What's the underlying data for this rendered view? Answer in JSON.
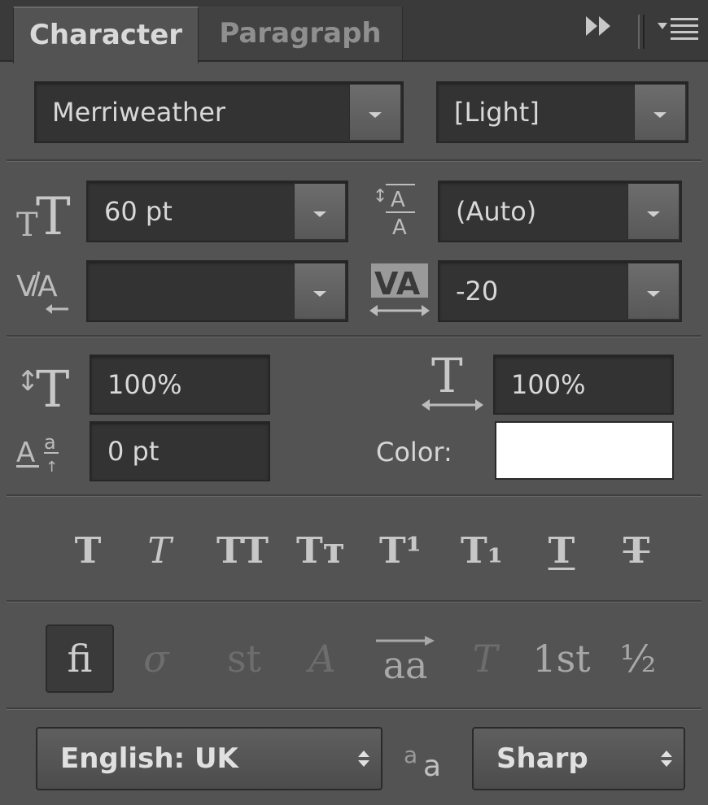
{
  "tabs": {
    "active": "Character",
    "inactive": "Paragraph"
  },
  "font": {
    "family": "Merriweather",
    "style": "[Light]"
  },
  "size": {
    "font_size": "60 pt",
    "leading": "(Auto)"
  },
  "spacing": {
    "kerning": "",
    "tracking": "-20"
  },
  "scale": {
    "vertical": "100%",
    "horizontal": "100%"
  },
  "baseline": {
    "shift": "0 pt"
  },
  "color": {
    "label": "Color:",
    "value": "#ffffff"
  },
  "type_styles": [
    {
      "name": "faux-bold-button",
      "glyph": "T"
    },
    {
      "name": "faux-italic-button",
      "glyph": "T"
    },
    {
      "name": "all-caps-button",
      "glyph": "TT"
    },
    {
      "name": "small-caps-button",
      "glyph": "Tт"
    },
    {
      "name": "superscript-button",
      "glyph": "T¹"
    },
    {
      "name": "subscript-button",
      "glyph": "T₁"
    },
    {
      "name": "underline-button",
      "glyph": "T"
    },
    {
      "name": "strikethrough-button",
      "glyph": "T"
    }
  ],
  "opentype": [
    {
      "name": "ligatures-button",
      "glyph": "fi"
    },
    {
      "name": "old-style-button",
      "glyph": "σ"
    },
    {
      "name": "discretionary-ligatures-button",
      "glyph": "st"
    },
    {
      "name": "swash-button",
      "glyph": "A"
    },
    {
      "name": "titling-alternates-button",
      "glyph": "aa"
    },
    {
      "name": "stylistic-alternates-button",
      "glyph": "T"
    },
    {
      "name": "ordinals-button",
      "glyph": "1st"
    },
    {
      "name": "fractions-button",
      "glyph": "½"
    }
  ],
  "language": {
    "value": "English: UK"
  },
  "antialias": {
    "value": "Sharp"
  }
}
